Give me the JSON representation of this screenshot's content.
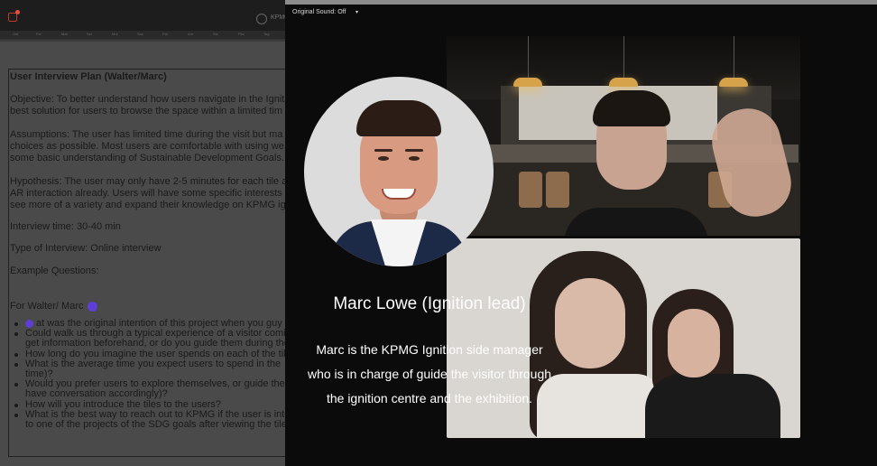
{
  "document": {
    "kpmg_label": "KPMG",
    "ruler_marks": [
      "Ost",
      "Pxl",
      "Mat",
      "Sel",
      "Mul",
      "Sss",
      "Pal",
      "Ars",
      "Sts",
      "Pks",
      "Tag"
    ],
    "title": "User Interview Plan (Walter/Marc)",
    "lines": [
      "Objective: To better understand how users navigate in the Igniti",
      "best solution for users to browse the space within a limited tim",
      "Assumptions: The user has limited time during the visit but ma",
      "choices as possible. Most users are comfortable with using we",
      "some basic understanding of Sustainable Development Goals.",
      "Hypothesis: The user may only have 2-5 minutes for each tile a",
      "AR interaction already. Users will have some specific interests i",
      "see more of a variety and expand their knowledge on KPMG ig",
      "Interview time: 30-40 min",
      "Type of Interview: Online interview",
      "Example Questions:",
      "For Walter/ Marc"
    ],
    "bullets": [
      "at was the original intention of this project when you guy",
      "Could walk us through a typical experience of a visitor comi",
      "get information beforehand, or do you guide them during the",
      "How long do you imagine the user spends on each of the tile",
      "What is the average time you expect users to spend in the",
      "time)?",
      "Would you prefer users to explore themselves, or guide the",
      "have conversation accordingly)?",
      "How will you introduce the tiles to the users?",
      "What is the best way to reach out to KPMG if the user is inte",
      "to one of the projects of the SDG goals after viewing the tile"
    ]
  },
  "video": {
    "sound_label": "Original Sound: Off",
    "sound_caret": "▾"
  },
  "caption": {
    "name": "Marc Lowe (Ignition lead)",
    "description_lines": [
      "Marc is the KPMG Ignition side manager",
      "who is in charge of guide the visitor through",
      "the ignition centre and the exhibition."
    ]
  },
  "colors": {
    "accent_avatar": "#5d3fd3",
    "record_red": "#e74c3c",
    "overlay": "#0b0b0b"
  }
}
